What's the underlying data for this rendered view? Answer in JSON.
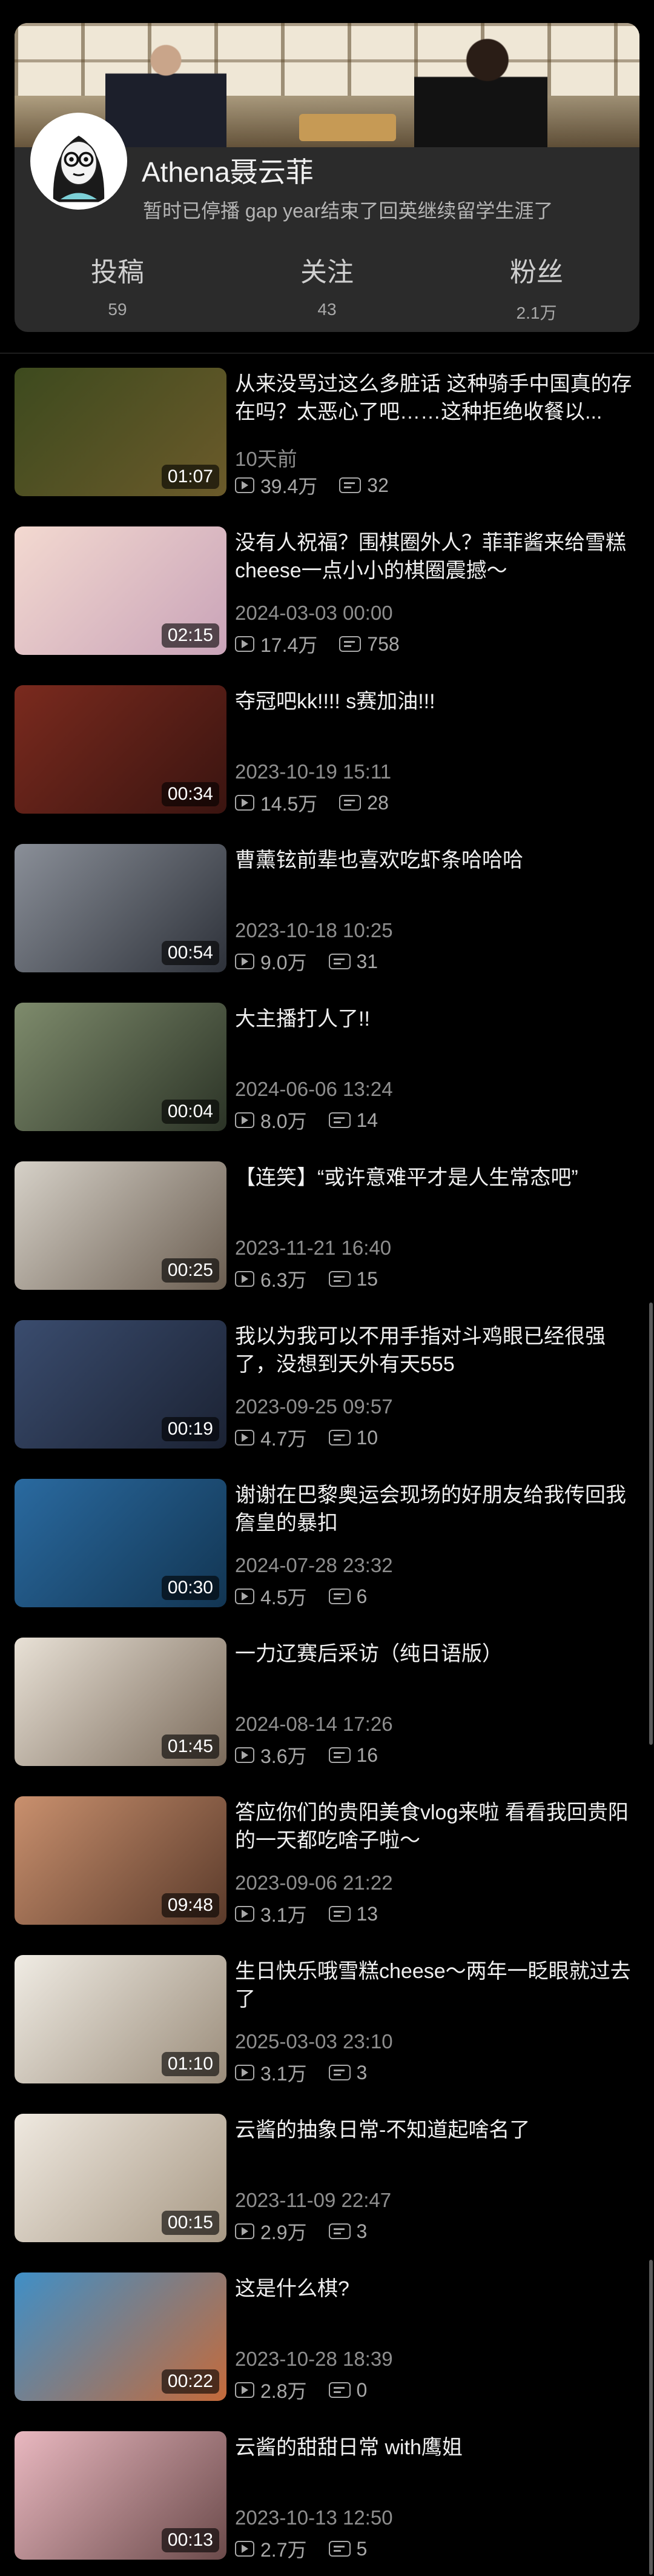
{
  "profile": {
    "name": "Athena聂云菲",
    "bio": "暂时已停播 gap year结束了回英继续留学生涯了",
    "stats": [
      {
        "label": "投稿",
        "value": "59"
      },
      {
        "label": "关注",
        "value": "43"
      },
      {
        "label": "粉丝",
        "value": "2.1万"
      }
    ]
  },
  "videos": [
    {
      "title": "从来没骂过这么多脏话 这种骑手中国真的存在吗？太恶心了吧……这种拒绝收餐以...",
      "date": "10天前",
      "views": "39.4万",
      "comments": "32",
      "duration": "01:07",
      "thumb_colors": [
        "#3d4a1e",
        "#6b5a2a"
      ]
    },
    {
      "title": "没有人祝福？围棋圈外人？菲菲酱来给雪糕cheese一点小小的棋圈震撼～",
      "date": "2024-03-03 00:00",
      "views": "17.4万",
      "comments": "758",
      "duration": "02:15",
      "thumb_colors": [
        "#f3d9d0",
        "#c9a3b8"
      ]
    },
    {
      "title": "夺冠吧kk!!!!  s赛加油!!!",
      "date": "2023-10-19 15:11",
      "views": "14.5万",
      "comments": "28",
      "duration": "00:34",
      "thumb_colors": [
        "#7a2a1e",
        "#3a1410"
      ]
    },
    {
      "title": "曹薰铉前辈也喜欢吃虾条哈哈哈",
      "date": "2023-10-18 10:25",
      "views": "9.0万",
      "comments": "31",
      "duration": "00:54",
      "thumb_colors": [
        "#8a8f98",
        "#2d3139"
      ]
    },
    {
      "title": "大主播打人了!!",
      "date": "2024-06-06 13:24",
      "views": "8.0万",
      "comments": "14",
      "duration": "00:04",
      "thumb_colors": [
        "#7e8b6c",
        "#2b3326"
      ]
    },
    {
      "title": "【连笑】“或许意难平才是人生常态吧”",
      "date": "2023-11-21 16:40",
      "views": "6.3万",
      "comments": "15",
      "duration": "00:25",
      "thumb_colors": [
        "#d6d1c8",
        "#6a5d50"
      ]
    },
    {
      "title": "我以为我可以不用手指对斗鸡眼已经很强了，没想到天外有天555",
      "date": "2023-09-25 09:57",
      "views": "4.7万",
      "comments": "10",
      "duration": "00:19",
      "thumb_colors": [
        "#3a4c6e",
        "#1b2233"
      ]
    },
    {
      "title": "谢谢在巴黎奥运会现场的好朋友给我传回我詹皇的暴扣",
      "date": "2024-07-28 23:32",
      "views": "4.5万",
      "comments": "6",
      "duration": "00:30",
      "thumb_colors": [
        "#2a6aa0",
        "#123552"
      ]
    },
    {
      "title": "一力辽赛后采访（纯日语版）",
      "date": "2024-08-14 17:26",
      "views": "3.6万",
      "comments": "16",
      "duration": "01:45",
      "thumb_colors": [
        "#e8e1d6",
        "#7a6a5a"
      ]
    },
    {
      "title": "答应你们的贵阳美食vlog来啦 看看我回贵阳的一天都吃啥子啦～",
      "date": "2023-09-06 21:22",
      "views": "3.1万",
      "comments": "13",
      "duration": "09:48",
      "thumb_colors": [
        "#c9906e",
        "#5a3a2a"
      ]
    },
    {
      "title": "生日快乐哦雪糕cheese～两年一眨眼就过去了",
      "date": "2025-03-03 23:10",
      "views": "3.1万",
      "comments": "3",
      "duration": "01:10",
      "thumb_colors": [
        "#f0ece4",
        "#9a8c7a"
      ]
    },
    {
      "title": "云酱的抽象日常-不知道起啥名了",
      "date": "2023-11-09 22:47",
      "views": "2.9万",
      "comments": "3",
      "duration": "00:15",
      "thumb_colors": [
        "#efe9e0",
        "#a79884"
      ]
    },
    {
      "title": "这是什么棋?",
      "date": "2023-10-28 18:39",
      "views": "2.8万",
      "comments": "0",
      "duration": "00:22",
      "thumb_colors": [
        "#3f8fc7",
        "#c56a3a"
      ]
    },
    {
      "title": "云酱的甜甜日常 with鹰姐",
      "date": "2023-10-13 12:50",
      "views": "2.7万",
      "comments": "5",
      "duration": "00:13",
      "thumb_colors": [
        "#e9b8c0",
        "#6b4a4a"
      ]
    }
  ]
}
